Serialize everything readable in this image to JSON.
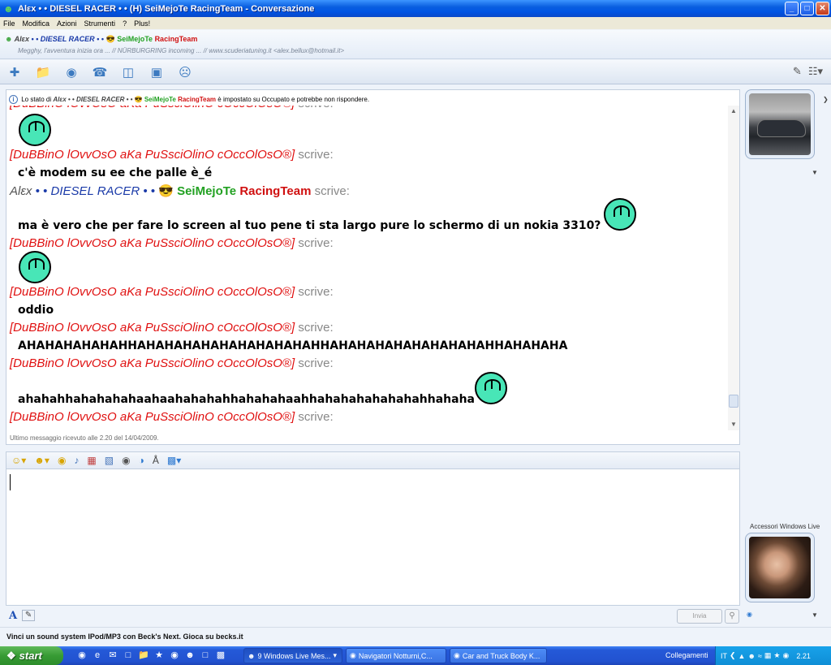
{
  "window": {
    "title": "Alεx • • DIESEL RACER • • (H) SeiMejoTe RacingTeam - Conversazione"
  },
  "menu": [
    "File",
    "Modifica",
    "Azioni",
    "Strumenti",
    "?",
    "Plus!"
  ],
  "contact": {
    "name_part1": "Alεx",
    "name_part2": "• • DIESEL RACER • •",
    "name_part3": "SeiMejoTe",
    "name_part4": "RacingTeam",
    "personal_message": "Megghy, l'avventura inizia ora ... // NÜRBURGRING incoming ... // www.scuderiatuning.it  <alex.bellux@hotmail.it>"
  },
  "status_notice": {
    "prefix": "Lo stato di",
    "name1": "Alεx • • DIESEL RACER • •",
    "name2": "SeiMejoTe",
    "name3": "RacingTeam",
    "suffix": "è impostato su Occupato e potrebbe non rispondere."
  },
  "chat": {
    "sender_dub": "[DuBBinO lOvvOsO aKa PuSsciOlinO cOccOlOsO®]",
    "sender_alex_a": "Alεx",
    "sender_alex_b": "• • DIESEL RACER • •",
    "sender_alex_c": "SeiMejoTe",
    "sender_alex_d": "RacingTeam",
    "scrive": "scrive:",
    "msg_modem": "c'è modem su ee che palle è_é",
    "msg_nokia": "ma è vero che per fare lo screen al tuo pene ti sta largo pure lo schermo di un nokia 3310?",
    "msg_oddio": "oddio",
    "msg_laugh1": "AHAHAHAHAHAHHAHAHAHAHAHAHAHAHAHAHHAHAHAHAHAHAHAHAHAHHAHAHAHA",
    "msg_laugh2": "ahahahhahahahahaahaahahahahhahahahaahhahahahahahahahhahaha",
    "last_received": "Ultimo messaggio ricevuto alle 2.20 del 14/04/2009."
  },
  "input": {
    "send_label": "Invia"
  },
  "sidebar": {
    "accessories_label": "Accessori Windows Live"
  },
  "ad_text": "Vinci un sound system IPod/MP3 con Beck's Next. Gioca su becks.it",
  "taskbar": {
    "start_label": "start",
    "tasks": [
      "9 Windows Live Mes...",
      "Navigatori Notturni,C...",
      "Car and Truck Body K..."
    ],
    "links_label": "Collegamenti",
    "lang": "IT",
    "clock": "2.21"
  }
}
